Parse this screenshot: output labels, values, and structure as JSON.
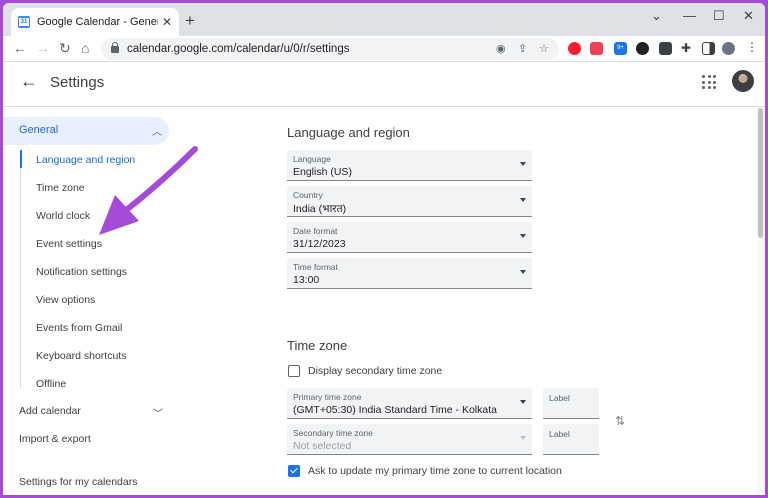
{
  "browser": {
    "tab_title": "Google Calendar - General settings",
    "tab_favicon": "calendar-icon",
    "url": "calendar.google.com/calendar/u/0/r/settings",
    "extension_badge": "9+"
  },
  "header": {
    "title": "Settings"
  },
  "sidebar": {
    "general_label": "General",
    "sub_items": [
      {
        "label": "Language and region"
      },
      {
        "label": "Time zone"
      },
      {
        "label": "World clock"
      },
      {
        "label": "Event settings"
      },
      {
        "label": "Notification settings"
      },
      {
        "label": "View options"
      },
      {
        "label": "Events from Gmail"
      },
      {
        "label": "Keyboard shortcuts"
      },
      {
        "label": "Offline"
      }
    ],
    "add_calendar": "Add calendar",
    "import_export": "Import & export",
    "my_calendars_heading": "Settings for my calendars"
  },
  "language_region": {
    "title": "Language and region",
    "language": {
      "label": "Language",
      "value": "English (US)"
    },
    "country": {
      "label": "Country",
      "value": "India (भारत)"
    },
    "date_format": {
      "label": "Date format",
      "value": "31/12/2023"
    },
    "time_format": {
      "label": "Time format",
      "value": "13:00"
    }
  },
  "time_zone": {
    "title": "Time zone",
    "display_secondary": "Display secondary time zone",
    "primary": {
      "label": "Primary time zone",
      "value": "(GMT+05:30) India Standard Time - Kolkata"
    },
    "primary_label_field": "Label",
    "secondary": {
      "label": "Secondary time zone",
      "value": "Not selected"
    },
    "secondary_label_field": "Label",
    "ask_update": "Ask to update my primary time zone to current location"
  },
  "colors": {
    "accent": "#1a73e8",
    "annotation": "#a64bd8"
  }
}
